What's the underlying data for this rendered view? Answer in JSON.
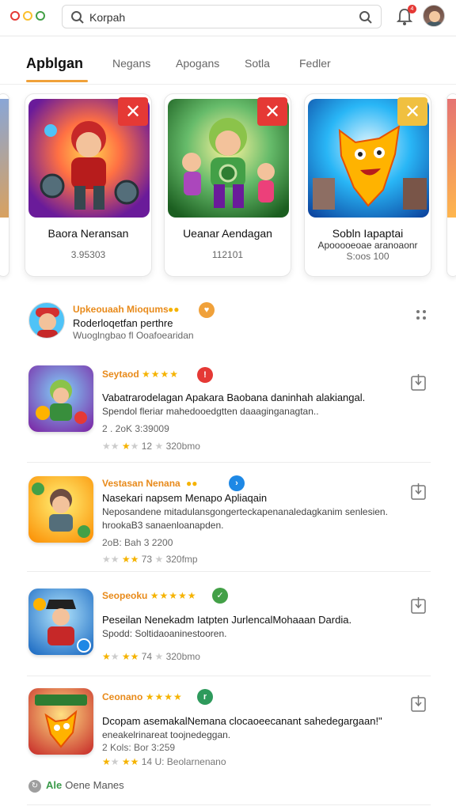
{
  "window": {
    "dot_colors": [
      "#e53935",
      "#fbc02d",
      "#43a047"
    ]
  },
  "search": {
    "query": "Korpah"
  },
  "header": {
    "notification_count": "4"
  },
  "tabs": [
    {
      "label": "Apblgan"
    },
    {
      "label": "Negans"
    },
    {
      "label": "Apogans"
    },
    {
      "label": "Sotla"
    },
    {
      "label": "Fedler"
    }
  ],
  "featured": [
    {
      "title": "Baora Neransan",
      "meta": "3.95303",
      "corner_icon": "close-x-icon",
      "corner_color": "#e53935"
    },
    {
      "title": "Ueanar Aendagan",
      "meta": "112101",
      "corner_icon": "close-x-icon",
      "corner_color": "#e53935"
    },
    {
      "title": "Sobln Iapaptai",
      "subtitle": "Apooooeoae aranoaonr",
      "meta": "S:oos 100",
      "corner_icon": "close-x-icon",
      "corner_color": "#f0c040"
    }
  ],
  "list_header": {
    "tag": "Upkeouaah Mioqums",
    "title": "Roderloqetfan perthre",
    "subtitle": "Wuoglngbao fl Ooafoearidan"
  },
  "apps": [
    {
      "tag": "Seytaod",
      "stars": "★★★★",
      "badge": "!",
      "badge_color": "#e53935",
      "title": "Vabatrarodelagan Apakara Baobana daninhah alakiangal.",
      "desc": "Spendol fleriar mahedooedgtten daaaginganagtan..",
      "meta": "2 . 2oK 3:39009",
      "rating_value": "12",
      "rating_count": "320bmo",
      "rating_fraction": 0.4
    },
    {
      "tag": "Vestasan Nenana",
      "stars": "",
      "badge": "›",
      "badge_color": "#1e88e5",
      "title": "Nasekari napsem Menapo Apliaqain",
      "desc": "Neposandene mitadulansgongerteckapenanaledagkanim senlesien.",
      "desc2": "hrookaB3 sanaenloanapden.",
      "meta": "2oB: Bah 3 2200",
      "rating_value": "73",
      "rating_count": "320fmp",
      "rating_fraction": 0.4
    },
    {
      "tag": "Seopeoku",
      "stars": "★★★★★",
      "badge": "✓",
      "badge_color": "#43a047",
      "title": "Peseilan Nenekadm Iatpten JurlencalMohaaan Dardia.",
      "desc": "Spodd: Soltidaoaninestooren.",
      "meta": "",
      "rating_value": "74",
      "rating_count": "320bmo",
      "rating_fraction": 0.4
    },
    {
      "tag": "Ceonano",
      "stars": "★★★★",
      "badge": "r",
      "badge_color": "#2e9a5c",
      "title": "Dcopam asemakalNemana clocaoeecanant sahedegargaan!\"",
      "desc": "eneakelrinareat toojnedeggan.",
      "meta": "2 Kols: Bor 3:259",
      "rating_value": "14",
      "rating_count": "Beolarnenano",
      "rating_fraction": 0.4
    }
  ],
  "footer": {
    "highlight": "Ale",
    "text": "Oene Manes"
  }
}
